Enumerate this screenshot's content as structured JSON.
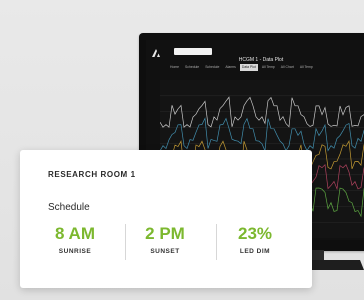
{
  "card": {
    "title": "RESEARCH ROOM 1",
    "subtitle": "Schedule",
    "accent_color": "#7cb82f",
    "stats": [
      {
        "value": "8 AM",
        "label": "SUNRISE"
      },
      {
        "value": "2 PM",
        "label": "SUNSET"
      },
      {
        "value": "23%",
        "label": "LED DIM"
      }
    ]
  },
  "screen": {
    "app_logo_icon": "app-logo-icon",
    "room_select": "",
    "title": "HCGM 1 - Data Plot",
    "tabs": [
      {
        "label": "Home",
        "active": false
      },
      {
        "label": "Schedule",
        "active": false
      },
      {
        "label": "Schedule",
        "active": false
      },
      {
        "label": "Alarms",
        "active": false
      },
      {
        "label": "Data Plot",
        "active": true
      },
      {
        "label": "All Temp",
        "active": false
      },
      {
        "label": "All Chart",
        "active": false
      },
      {
        "label": "All Temp",
        "active": false
      }
    ],
    "series_colors": [
      "#e8e8e8",
      "#4aa3c8",
      "#e0b13a",
      "#c94a6a",
      "#6ac04a"
    ]
  }
}
